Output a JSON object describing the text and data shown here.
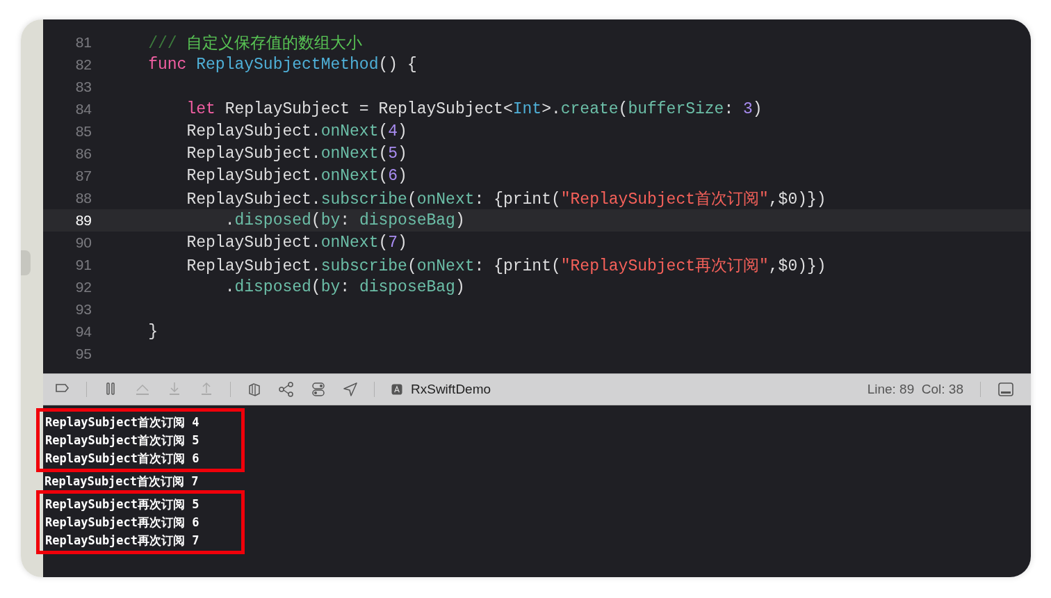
{
  "editor": {
    "lines": [
      {
        "number": "81",
        "current": false,
        "tokens": [
          {
            "kind": "comment-mark",
            "text": "    ///"
          },
          {
            "kind": "comment",
            "text": " 自定义保存值的数组大小"
          }
        ]
      },
      {
        "number": "82",
        "current": false,
        "tokens": [
          {
            "kind": "keyword",
            "text": "    func "
          },
          {
            "kind": "decl",
            "text": "ReplaySubjectMethod"
          },
          {
            "kind": "plain",
            "text": "() {"
          }
        ]
      },
      {
        "number": "83",
        "current": false
      },
      {
        "number": "84",
        "current": false,
        "tokens": [
          {
            "kind": "keyword",
            "text": "        let"
          },
          {
            "kind": "plain",
            "text": " ReplaySubject = ReplaySubject<"
          },
          {
            "kind": "type",
            "text": "Int"
          },
          {
            "kind": "plain",
            "text": ">."
          },
          {
            "kind": "method",
            "text": "create"
          },
          {
            "kind": "plain",
            "text": "("
          },
          {
            "kind": "method",
            "text": "bufferSize"
          },
          {
            "kind": "plain",
            "text": ": "
          },
          {
            "kind": "number",
            "text": "3"
          },
          {
            "kind": "plain",
            "text": ")"
          }
        ]
      },
      {
        "number": "85",
        "current": false,
        "tokens": [
          {
            "kind": "plain",
            "text": "        ReplaySubject."
          },
          {
            "kind": "method",
            "text": "onNext"
          },
          {
            "kind": "plain",
            "text": "("
          },
          {
            "kind": "number",
            "text": "4"
          },
          {
            "kind": "plain",
            "text": ")"
          }
        ]
      },
      {
        "number": "86",
        "current": false,
        "tokens": [
          {
            "kind": "plain",
            "text": "        ReplaySubject."
          },
          {
            "kind": "method",
            "text": "onNext"
          },
          {
            "kind": "plain",
            "text": "("
          },
          {
            "kind": "number",
            "text": "5"
          },
          {
            "kind": "plain",
            "text": ")"
          }
        ]
      },
      {
        "number": "87",
        "current": false,
        "tokens": [
          {
            "kind": "plain",
            "text": "        ReplaySubject."
          },
          {
            "kind": "method",
            "text": "onNext"
          },
          {
            "kind": "plain",
            "text": "("
          },
          {
            "kind": "number",
            "text": "6"
          },
          {
            "kind": "plain",
            "text": ")"
          }
        ]
      },
      {
        "number": "88",
        "current": false,
        "tokens": [
          {
            "kind": "plain",
            "text": "        ReplaySubject."
          },
          {
            "kind": "method",
            "text": "subscribe"
          },
          {
            "kind": "plain",
            "text": "("
          },
          {
            "kind": "method",
            "text": "onNext"
          },
          {
            "kind": "plain",
            "text": ": {print("
          },
          {
            "kind": "string",
            "text": "\"ReplaySubject首次订阅\""
          },
          {
            "kind": "plain",
            "text": ",$0)})"
          }
        ]
      },
      {
        "number": "89",
        "current": true,
        "tokens": [
          {
            "kind": "plain",
            "text": "            ."
          },
          {
            "kind": "method",
            "text": "disposed"
          },
          {
            "kind": "plain",
            "text": "("
          },
          {
            "kind": "method",
            "text": "by"
          },
          {
            "kind": "plain",
            "text": ": "
          },
          {
            "kind": "method",
            "text": "disposeBag"
          },
          {
            "kind": "plain",
            "text": ")"
          }
        ]
      },
      {
        "number": "90",
        "current": false,
        "tokens": [
          {
            "kind": "plain",
            "text": "        ReplaySubject."
          },
          {
            "kind": "method",
            "text": "onNext"
          },
          {
            "kind": "plain",
            "text": "("
          },
          {
            "kind": "number",
            "text": "7"
          },
          {
            "kind": "plain",
            "text": ")"
          }
        ]
      },
      {
        "number": "91",
        "current": false,
        "tokens": [
          {
            "kind": "plain",
            "text": "        ReplaySubject."
          },
          {
            "kind": "method",
            "text": "subscribe"
          },
          {
            "kind": "plain",
            "text": "("
          },
          {
            "kind": "method",
            "text": "onNext"
          },
          {
            "kind": "plain",
            "text": ": {print("
          },
          {
            "kind": "string",
            "text": "\"ReplaySubject再次订阅\""
          },
          {
            "kind": "plain",
            "text": ",$0)})"
          }
        ]
      },
      {
        "number": "92",
        "current": false,
        "tokens": [
          {
            "kind": "plain",
            "text": "            ."
          },
          {
            "kind": "method",
            "text": "disposed"
          },
          {
            "kind": "plain",
            "text": "("
          },
          {
            "kind": "method",
            "text": "by"
          },
          {
            "kind": "plain",
            "text": ": "
          },
          {
            "kind": "method",
            "text": "disposeBag"
          },
          {
            "kind": "plain",
            "text": ")"
          }
        ]
      },
      {
        "number": "93",
        "current": false
      },
      {
        "number": "94",
        "current": false,
        "tokens": [
          {
            "kind": "plain",
            "text": "    }"
          }
        ]
      },
      {
        "number": "95",
        "current": false
      }
    ]
  },
  "debug_bar": {
    "scheme": "RxSwiftDemo",
    "position": "Line: 89  Col: 38"
  },
  "console": {
    "groups": [
      {
        "boxed": true,
        "lines": [
          "ReplaySubject首次订阅 4",
          "ReplaySubject首次订阅 5",
          "ReplaySubject首次订阅 6"
        ]
      },
      {
        "boxed": false,
        "lines": [
          "ReplaySubject首次订阅 7"
        ]
      },
      {
        "boxed": true,
        "lines": [
          "ReplaySubject再次订阅 5",
          "ReplaySubject再次订阅 6",
          "ReplaySubject再次订阅 7"
        ]
      }
    ]
  }
}
